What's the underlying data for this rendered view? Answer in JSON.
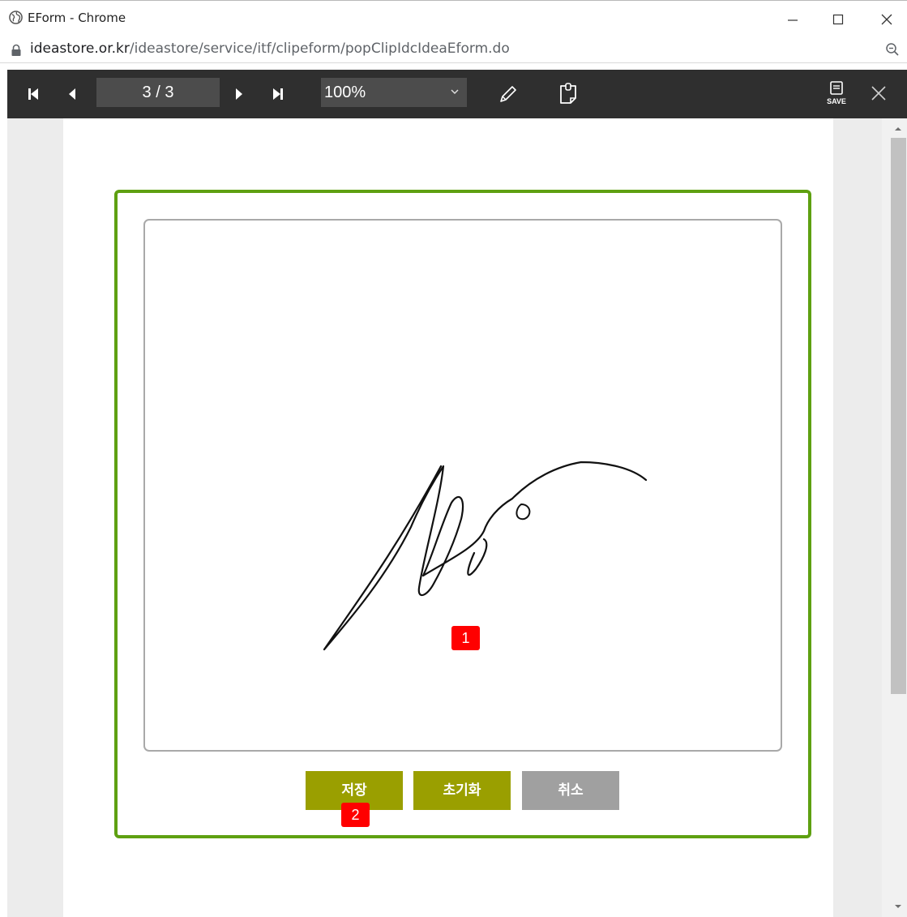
{
  "window": {
    "title": "EForm - Chrome"
  },
  "address_bar": {
    "host": "ideastore.or.kr",
    "path": "/ideastore/service/itf/clipeform/popClipIdcIdeaEform.do"
  },
  "toolbar": {
    "page_indicator": "3 / 3",
    "zoom_value": "100%",
    "save_label": "SAVE"
  },
  "signature_panel": {
    "frame_color": "#5ea011",
    "buttons": {
      "save": {
        "label": "저장",
        "color": "#9a9f00"
      },
      "reset": {
        "label": "초기화",
        "color": "#9a9f00"
      },
      "cancel": {
        "label": "취소",
        "color": "#a0a0a0"
      }
    }
  },
  "markers": [
    {
      "label": "1"
    },
    {
      "label": "2"
    }
  ]
}
